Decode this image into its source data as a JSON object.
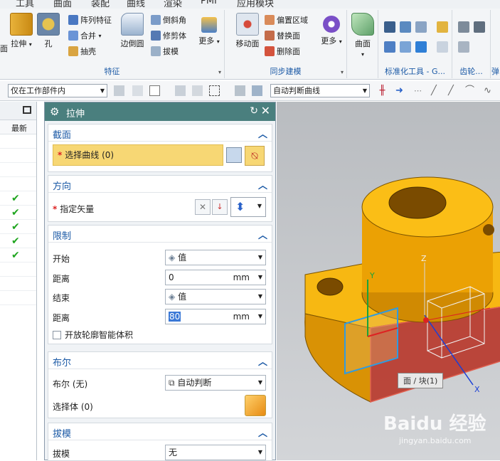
{
  "menu": [
    "工具",
    "曲面",
    "装配",
    "曲线",
    "渲染",
    "PMI",
    "应用模块"
  ],
  "ribbon": {
    "feature_group": {
      "label": "特征",
      "buttons": {
        "extrude": "拉伸",
        "hole": "孔",
        "pattern": "阵列特征",
        "unite": "合并",
        "shell": "抽壳",
        "edge_blend": "边倒圆",
        "chamfer": "倒斜角",
        "trim_body": "修剪体",
        "draft": "拔模",
        "more": "更多"
      },
      "cut_text": "面"
    },
    "sync_group": {
      "label": "同步建模",
      "buttons": {
        "move_face": "移动面",
        "offset_region": "偏置区域",
        "replace_face": "替换面",
        "delete_face": "删除面",
        "more": "更多"
      }
    },
    "surface_group": {
      "label": "",
      "buttons": {
        "surface": "曲面"
      }
    },
    "std_group": {
      "label": "标准化工具 - G..."
    },
    "gear_group": {
      "label": "齿轮..."
    },
    "spring_group": {
      "label": "弹"
    }
  },
  "toolbar": {
    "selection_scope": "仅在工作部件内",
    "curve_rule": "自动判断曲线"
  },
  "navigator": {
    "column_header": "最新",
    "checked_rows": 5
  },
  "dialog": {
    "title": "拉伸",
    "section_section": {
      "title": "截面",
      "select_curve": "选择曲线 (0)"
    },
    "direction": {
      "title": "方向",
      "specify_vector": "指定矢量"
    },
    "limits": {
      "title": "限制",
      "start_label": "开始",
      "start_value": "值",
      "distance1_label": "距离",
      "distance1_value": "0",
      "distance1_unit": "mm",
      "end_label": "结束",
      "end_value": "值",
      "distance2_label": "距离",
      "distance2_value": "80",
      "distance2_unit": "mm",
      "open_profile": "开放轮廓智能体积"
    },
    "boolean": {
      "title": "布尔",
      "boolean_label": "布尔 (无)",
      "boolean_value": "自动判断",
      "select_body": "选择体 (0)"
    },
    "draft": {
      "title": "拔模",
      "draft_label": "拔模",
      "draft_value": "无"
    }
  },
  "viewport": {
    "tooltip": "面 / 块(1)",
    "axis_z": "Z",
    "axis_y": "Y",
    "axis_x": "X",
    "watermark_main": "Baidu 经验",
    "watermark_url": "jingyan.baidu.com"
  },
  "colors": {
    "title_bar": "#4a7f7e",
    "accent_blue": "#1c5aa6",
    "selection_yellow": "#f7d774",
    "part_orange": "#f0a800",
    "part_red": "#b83a2c"
  }
}
